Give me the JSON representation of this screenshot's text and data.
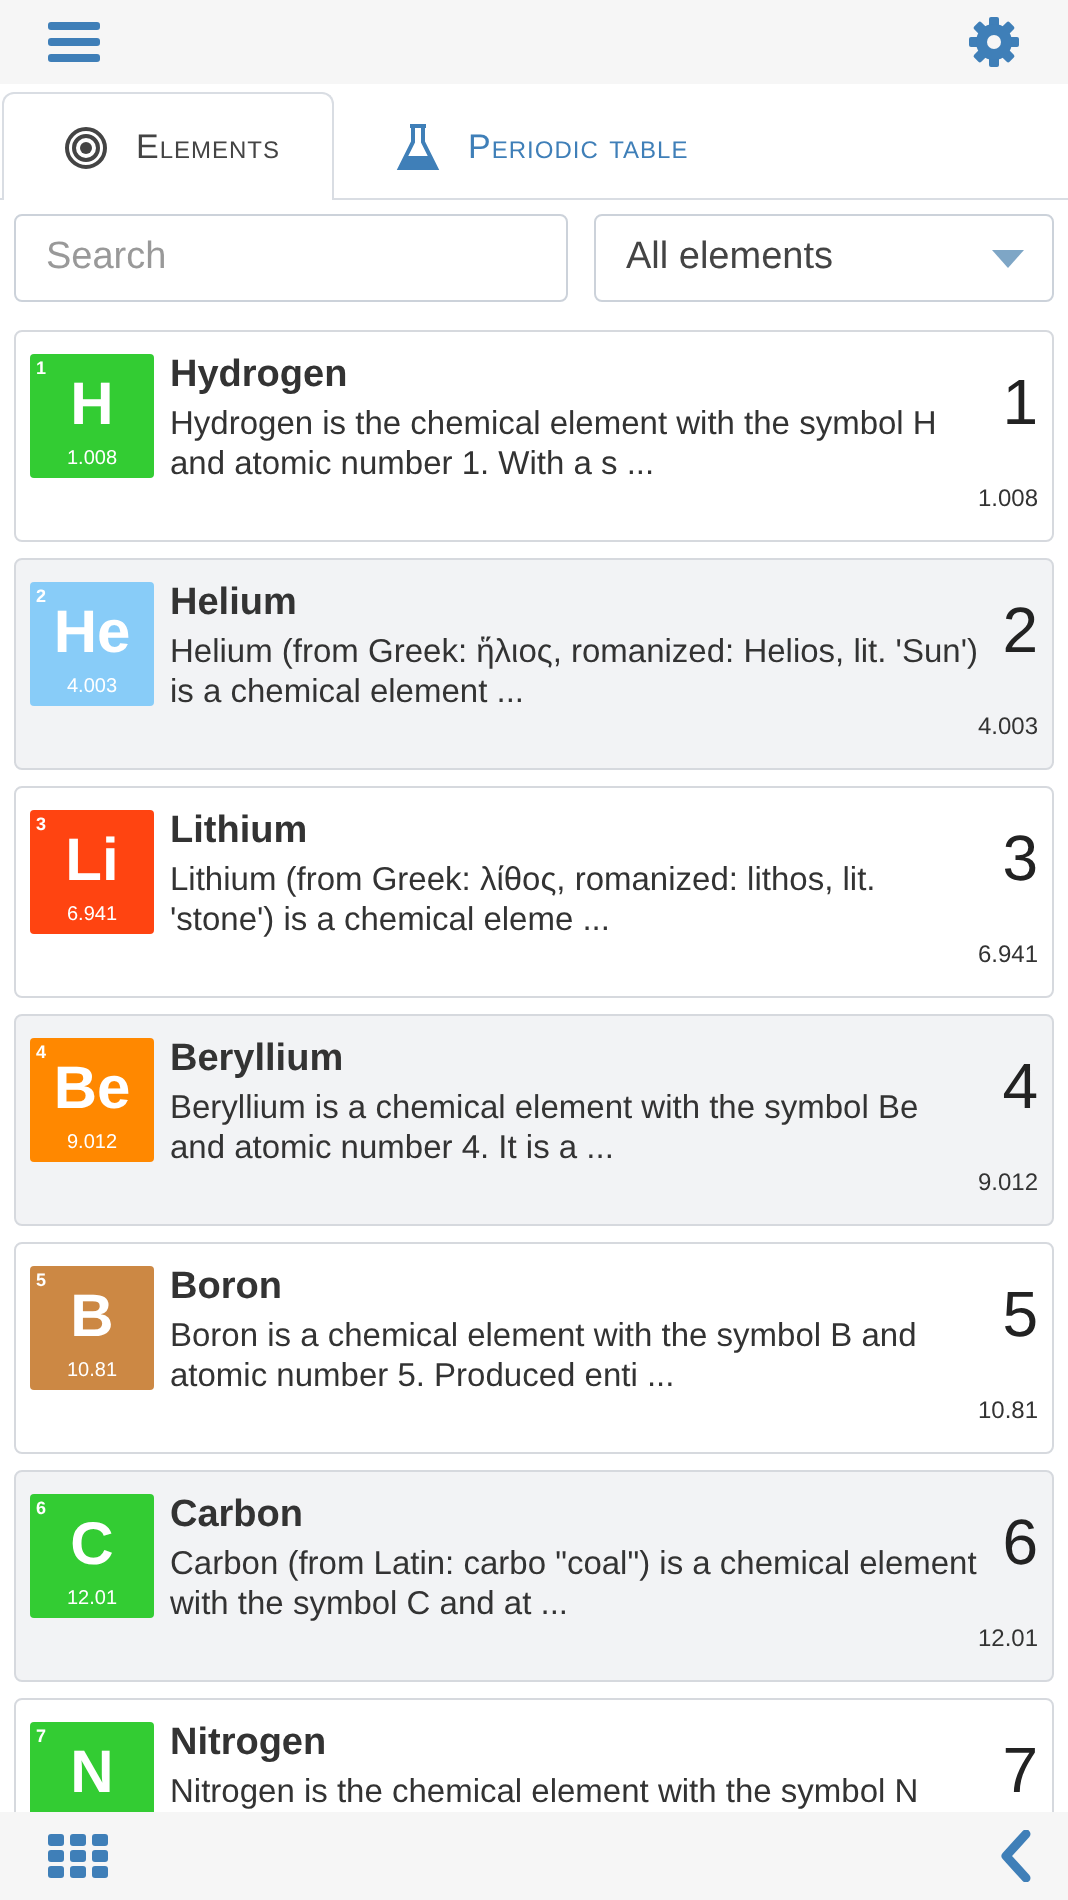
{
  "tabs": [
    {
      "label": "Elements",
      "selected": true
    },
    {
      "label": "Periodic table",
      "selected": false
    }
  ],
  "search": {
    "placeholder": "Search"
  },
  "filter": {
    "value": "All elements"
  },
  "elements": [
    {
      "tile_number": "1",
      "symbol": "H",
      "tile_weight": "1.008",
      "color": "#33cc33",
      "name": "Hydrogen",
      "description": "Hydrogen is the chemical element with the symbol H and atomic number 1. With a s ...",
      "number": "1",
      "weight": "1.008"
    },
    {
      "tile_number": "2",
      "symbol": "He",
      "tile_weight": "4.003",
      "color": "#88ccf8",
      "name": "Helium",
      "description": "Helium (from Greek: ἥλιος, romanized: Helios, lit. 'Sun') is a chemical element ...",
      "number": "2",
      "weight": "4.003"
    },
    {
      "tile_number": "3",
      "symbol": "Li",
      "tile_weight": "6.941",
      "color": "#ff4411",
      "name": "Lithium",
      "description": "Lithium (from Greek: λίθος, romanized: lithos, lit. 'stone') is a chemical eleme ...",
      "number": "3",
      "weight": "6.941"
    },
    {
      "tile_number": "4",
      "symbol": "Be",
      "tile_weight": "9.012",
      "color": "#ff8800",
      "name": "Beryllium",
      "description": "Beryllium is a chemical element with the symbol Be and atomic number 4. It is a ...",
      "number": "4",
      "weight": "9.012"
    },
    {
      "tile_number": "5",
      "symbol": "B",
      "tile_weight": "10.81",
      "color": "#cc8844",
      "name": "Boron",
      "description": "Boron is a chemical element with the symbol B and atomic number 5. Produced enti ...",
      "number": "5",
      "weight": "10.81"
    },
    {
      "tile_number": "6",
      "symbol": "C",
      "tile_weight": "12.01",
      "color": "#33cc33",
      "name": "Carbon",
      "description": "Carbon (from Latin: carbo \"coal\") is a chemical element with the symbol C and at ...",
      "number": "6",
      "weight": "12.01"
    },
    {
      "tile_number": "7",
      "symbol": "N",
      "color": "#33cc33",
      "name": "Nitrogen",
      "description": "Nitrogen is the chemical element with the symbol N",
      "number": "7"
    }
  ]
}
